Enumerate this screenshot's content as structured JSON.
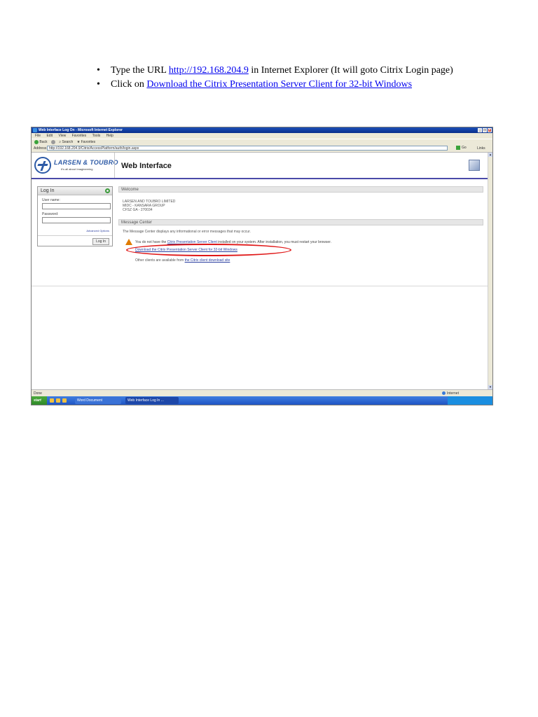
{
  "instructions": {
    "step1": {
      "prefix": "Type the URL ",
      "url": "http://192.168.204.9",
      "suffix": " in Internet Explorer (It will goto Citrix Login page)"
    },
    "step2": {
      "prefix": "Click on ",
      "link": "Download the Citrix Presentation Server Client for 32-bit Windows"
    }
  },
  "browser": {
    "title": "Web Interface Log On - Microsoft Internet Explorer",
    "menu": [
      "File",
      "Edit",
      "View",
      "Favorites",
      "Tools",
      "Help"
    ],
    "toolbar": {
      "back": "Back",
      "search": "Search",
      "favorites": "Favorites"
    },
    "address_label": "Address",
    "address_value": "http://192.168.204.9/Citrix/AccessPlatform/auth/login.aspx",
    "go_label": "Go",
    "links_label": "Links",
    "status_text": "Done",
    "zone_label": "Internet"
  },
  "header": {
    "brand": "LARSEN & TOUBRO",
    "tagline": "It's all about Imagineering",
    "title": "Web Interface"
  },
  "login": {
    "heading": "Log In",
    "username_label": "User name:",
    "password_label": "Password:",
    "advanced_options": "Advanced Options",
    "login_button": "Log In"
  },
  "welcome": {
    "heading": "Welcome",
    "lines": [
      "LARSEN AND TOUBRO LIMITED",
      "MIDC - KANSARA GROUP",
      "CFSZ GA - 270034"
    ]
  },
  "message_center": {
    "heading": "Message Center",
    "intro": "The Message Center displays any informational or error messages that may occur.",
    "warning_prefix": "You do not have the ",
    "warning_link": "Citrix Presentation Server Client",
    "warning_suffix": " installed on your system. After installation, you must restart your browser.",
    "download_link": "Download the Citrix Presentation Server Client for 32-bit Windows",
    "other_prefix": "Other clients are available from ",
    "other_link": "the Citrix client download site"
  },
  "taskbar": {
    "start": "start",
    "task1": "Word Document",
    "task2": "Web Interface Log In ..."
  }
}
